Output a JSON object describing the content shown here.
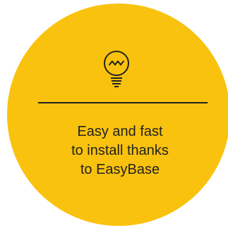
{
  "feature": {
    "icon": "lightbulb-icon",
    "caption_lines": [
      "Easy and fast",
      "to install thanks",
      "to EasyBase"
    ]
  },
  "colors": {
    "circle": "#f9c20e",
    "ink": "#222222"
  }
}
